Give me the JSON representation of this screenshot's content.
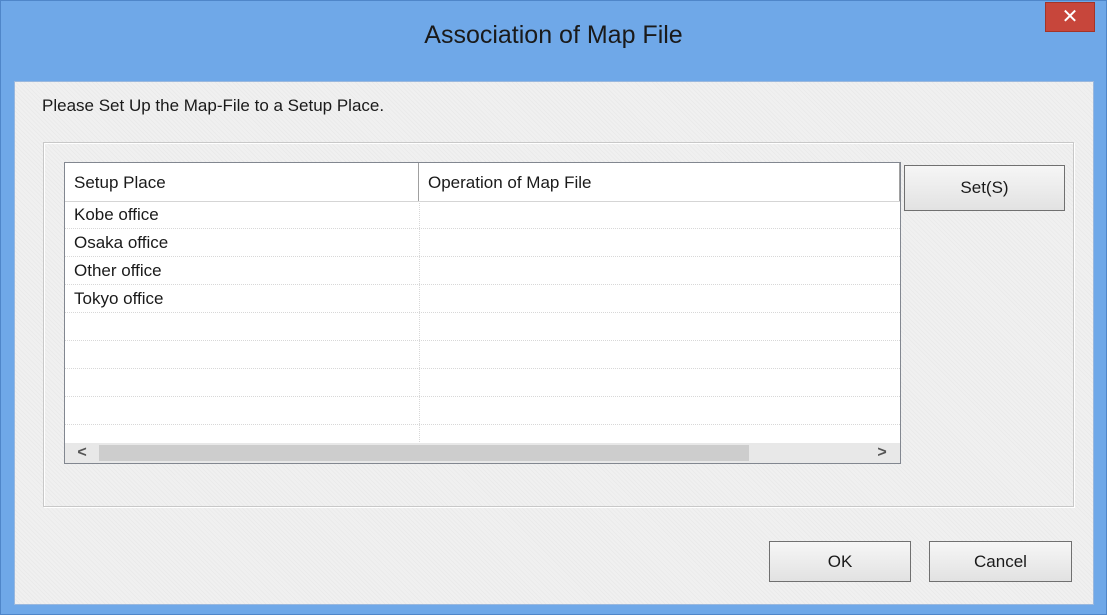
{
  "window": {
    "title": "Association of Map File",
    "close_glyph": "✕"
  },
  "instruction": "Please Set Up the Map-File to a Setup Place.",
  "list": {
    "columns": [
      "Setup Place",
      "Operation of Map File"
    ],
    "rows": [
      [
        "Kobe office",
        ""
      ],
      [
        "Osaka office",
        ""
      ],
      [
        "Other office",
        ""
      ],
      [
        "Tokyo office",
        ""
      ],
      [
        "",
        ""
      ],
      [
        "",
        ""
      ],
      [
        "",
        ""
      ],
      [
        "",
        ""
      ],
      [
        "",
        ""
      ]
    ],
    "scroll_left_glyph": "<",
    "scroll_right_glyph": ">"
  },
  "buttons": {
    "set": "Set(S)",
    "ok": "OK",
    "cancel": "Cancel"
  },
  "icons": {
    "close": "close-icon",
    "scroll_left": "chevron-left-icon",
    "scroll_right": "chevron-right-icon"
  }
}
